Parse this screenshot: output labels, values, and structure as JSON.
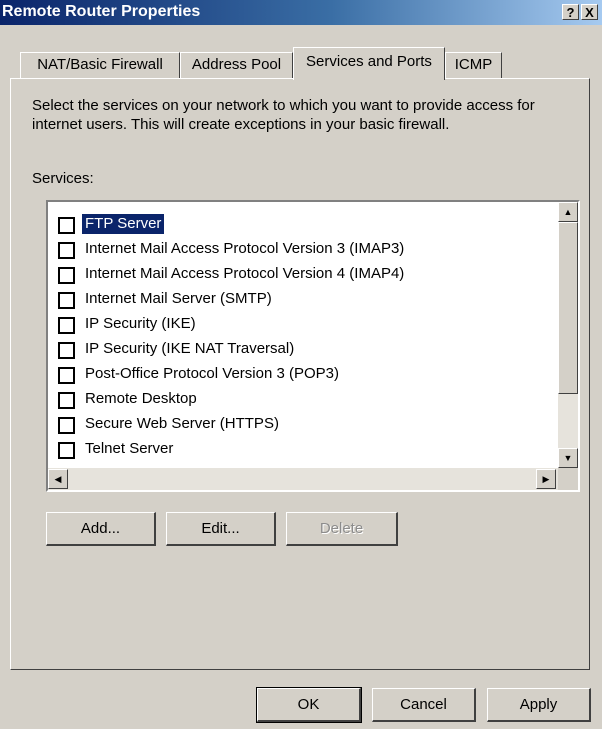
{
  "window": {
    "title": "Remote Router Properties",
    "help_button": "?",
    "close_button": "X"
  },
  "tabs": [
    {
      "label": "NAT/Basic Firewall",
      "active": false
    },
    {
      "label": "Address Pool",
      "active": false
    },
    {
      "label": "Services and Ports",
      "active": true
    },
    {
      "label": "ICMP",
      "active": false
    }
  ],
  "description": "Select the services on your network to which you want to provide access for internet users.  This will create exceptions in your basic firewall.",
  "services_label": "Services:",
  "services": [
    {
      "label": "FTP Server",
      "checked": false,
      "selected": true
    },
    {
      "label": "Internet Mail Access Protocol Version 3 (IMAP3)",
      "checked": false,
      "selected": false
    },
    {
      "label": "Internet Mail Access Protocol Version 4 (IMAP4)",
      "checked": false,
      "selected": false
    },
    {
      "label": "Internet Mail Server (SMTP)",
      "checked": false,
      "selected": false
    },
    {
      "label": "IP Security (IKE)",
      "checked": false,
      "selected": false
    },
    {
      "label": "IP Security (IKE NAT Traversal)",
      "checked": false,
      "selected": false
    },
    {
      "label": "Post-Office Protocol Version 3 (POP3)",
      "checked": false,
      "selected": false
    },
    {
      "label": "Remote Desktop",
      "checked": false,
      "selected": false
    },
    {
      "label": "Secure Web Server (HTTPS)",
      "checked": false,
      "selected": false
    },
    {
      "label": "Telnet Server",
      "checked": false,
      "selected": false
    }
  ],
  "list_buttons": {
    "add": "Add...",
    "edit": "Edit...",
    "delete": "Delete"
  },
  "dialog_buttons": {
    "ok": "OK",
    "cancel": "Cancel",
    "apply": "Apply"
  },
  "scrollbar_icons": {
    "up": "triangle-up-icon",
    "down": "triangle-down-icon",
    "left": "triangle-left-icon",
    "right": "triangle-right-icon"
  },
  "colors": {
    "selection": "#0a246a",
    "titlebar_start": "#0a246a",
    "titlebar_end": "#a6caf0",
    "dialog_bg": "#d4d0c8"
  }
}
